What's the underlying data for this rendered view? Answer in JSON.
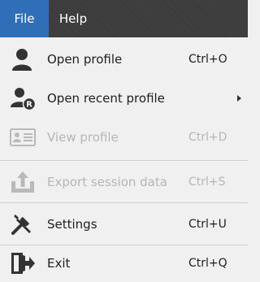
{
  "menubar": {
    "items": [
      {
        "label": "File"
      },
      {
        "label": "Help"
      }
    ]
  },
  "menu": {
    "items": [
      {
        "label": "Open profile",
        "shortcut": "Ctrl+O",
        "icon": "user-icon",
        "enabled": true
      },
      {
        "label": "Open recent profile",
        "shortcut": "",
        "icon": "recent-profile-icon",
        "enabled": true,
        "submenu": true
      },
      {
        "label": "View profile",
        "shortcut": "Ctrl+D",
        "icon": "id-card-icon",
        "enabled": false
      },
      {
        "label": "Export session data",
        "shortcut": "Ctrl+S",
        "icon": "export-icon",
        "enabled": false
      },
      {
        "label": "Settings",
        "shortcut": "Ctrl+U",
        "icon": "tools-icon",
        "enabled": true
      },
      {
        "label": "Exit",
        "shortcut": "Ctrl+Q",
        "icon": "exit-icon",
        "enabled": true
      }
    ],
    "recent_badge": "R"
  },
  "colors": {
    "menubar_bg": "#3a3a3a",
    "active_menu_bg": "#2f6fb7",
    "menu_bg": "#f0f0f0",
    "enabled_text": "#1e1e1e",
    "disabled_text": "#b6b6b6"
  }
}
